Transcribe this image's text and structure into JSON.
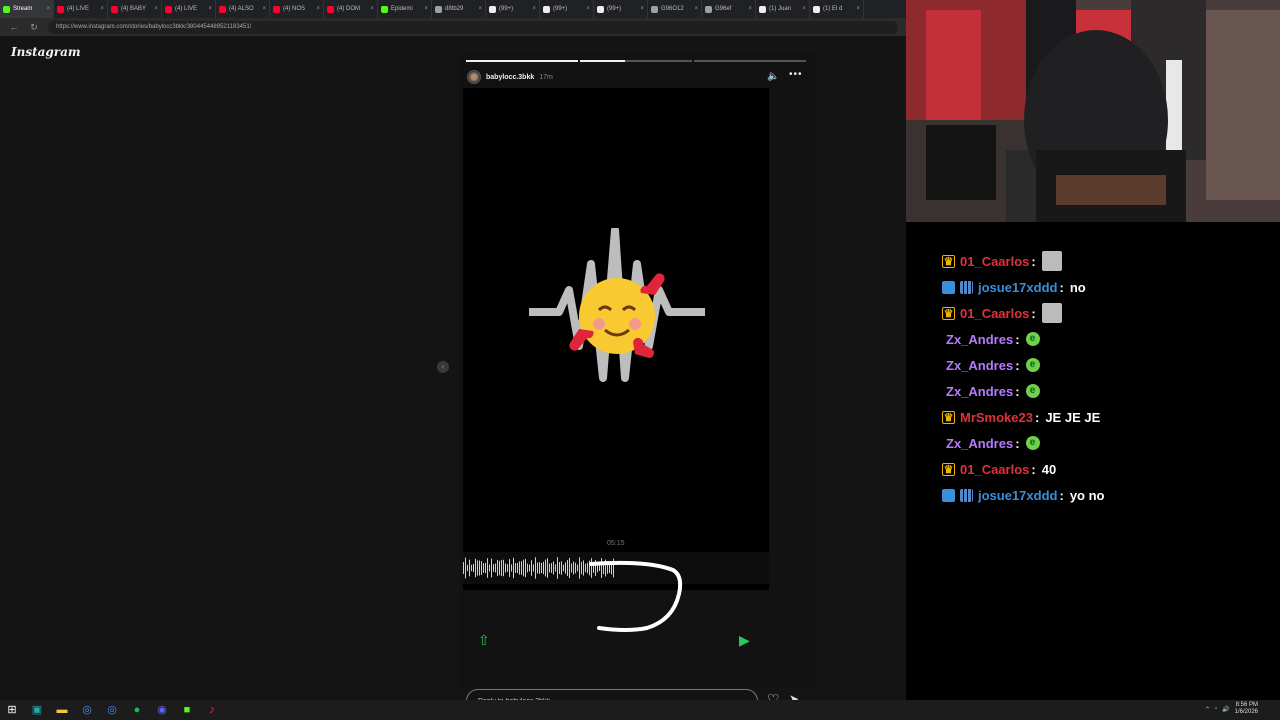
{
  "browser": {
    "tabs": [
      {
        "label": "Stream",
        "color": "#53fc18"
      },
      {
        "label": "(4) LIVE",
        "color": "#ff0033"
      },
      {
        "label": "(4) BABY",
        "color": "#ff0033"
      },
      {
        "label": "(4) LIVE",
        "color": "#ff0033"
      },
      {
        "label": "(4) ALSO",
        "color": "#ff0033"
      },
      {
        "label": "(4) NOS",
        "color": "#ff0033"
      },
      {
        "label": "(4) DOM",
        "color": "#ff0033"
      },
      {
        "label": "Epidemi",
        "color": "#53fc18"
      },
      {
        "label": "d8tb29",
        "color": "#9aa0a6"
      },
      {
        "label": "(99+)",
        "color": "#eeeeee"
      },
      {
        "label": "(99+)",
        "color": "#eeeeee"
      },
      {
        "label": "(99+)",
        "color": "#eeeeee"
      },
      {
        "label": "G96O12",
        "color": "#9aa0a6"
      },
      {
        "label": "G96ef",
        "color": "#9aa0a6"
      },
      {
        "label": "(1) Juan",
        "color": "#eeeeee"
      },
      {
        "label": "(1) El d",
        "color": "#eeeeee"
      }
    ],
    "url": "https://www.instagram.com/stories/babylocc3bkk/3804454489521183451/",
    "back_glyph": "←",
    "reload_glyph": "↻"
  },
  "instagram": {
    "logo": "Instagram",
    "story": {
      "username": "babylocc.3bkk",
      "time_ago": "17m",
      "timestamp": "05:15",
      "reply_placeholder": "Reply to babylocc.3bkk...",
      "progress": [
        1,
        0.4,
        0
      ],
      "icons": {
        "mute": "mute-icon",
        "more": "more-icon",
        "share": "share-icon",
        "play": "play-icon",
        "heart": "heart-icon",
        "send": "send-icon",
        "prev": "chevron-left-icon"
      }
    }
  },
  "chat": {
    "messages": [
      {
        "user": "01_Caarlos",
        "color": "#e0323c",
        "badges": [
          "crown"
        ],
        "text": "",
        "emote": "face"
      },
      {
        "user": "josue17xddd",
        "color": "#3a8fd8",
        "badges": [
          "blue",
          "grid"
        ],
        "text": "no",
        "emote": ""
      },
      {
        "user": "01_Caarlos",
        "color": "#e0323c",
        "badges": [
          "crown"
        ],
        "text": "",
        "emote": "face"
      },
      {
        "user": "Zx_Andres",
        "color": "#b57bff",
        "badges": [],
        "text": "",
        "emote": "green"
      },
      {
        "user": "Zx_Andres",
        "color": "#b57bff",
        "badges": [],
        "text": "",
        "emote": "green"
      },
      {
        "user": "Zx_Andres",
        "color": "#b57bff",
        "badges": [],
        "text": "",
        "emote": "green"
      },
      {
        "user": "MrSmoke23",
        "color": "#e0323c",
        "badges": [
          "crown"
        ],
        "text": "JE JE JE",
        "emote": ""
      },
      {
        "user": "Zx_Andres",
        "color": "#b57bff",
        "badges": [],
        "text": "",
        "emote": "green"
      },
      {
        "user": "01_Caarlos",
        "color": "#e0323c",
        "badges": [
          "crown"
        ],
        "text": "40",
        "emote": ""
      },
      {
        "user": "josue17xddd",
        "color": "#3a8fd8",
        "badges": [
          "blue",
          "grid"
        ],
        "text": "yo no",
        "emote": ""
      }
    ],
    "separator": ":"
  },
  "taskbar": {
    "icons": [
      "windows-start-icon",
      "terminal-icon",
      "file-explorer-icon",
      "chrome-icon",
      "chrome-icon",
      "spotify-icon",
      "discord-icon",
      "kick-icon",
      "tiktok-icon"
    ],
    "time": "8:56 PM",
    "date": "1/6/2026"
  }
}
